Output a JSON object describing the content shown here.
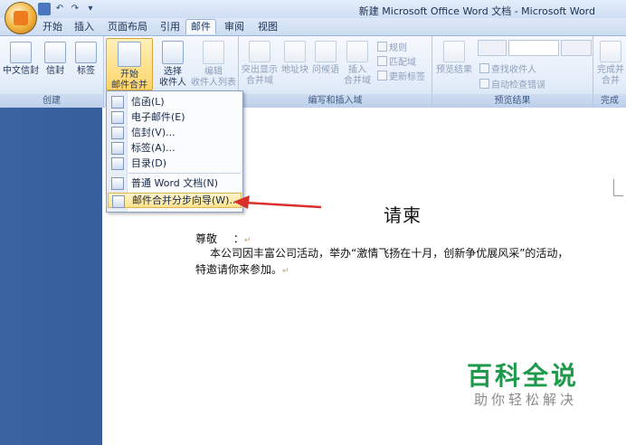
{
  "title": "新建 Microsoft Office Word 文档 - Microsoft Word",
  "tabs": [
    "开始",
    "插入",
    "页面布局",
    "引用",
    "邮件",
    "审阅",
    "视图"
  ],
  "ribbon": {
    "create": {
      "label": "创建",
      "buttons": [
        "中文信封",
        "信封",
        "标签"
      ]
    },
    "start": {
      "btn1_line1": "开始",
      "btn1_line2": "邮件合并",
      "btn2_line1": "选择",
      "btn2_line2": "收件人",
      "btn3_line1": "编辑",
      "btn3_line2": "收件人列表"
    },
    "write": {
      "label": "编写和插入域",
      "b1_line1": "突出显示",
      "b1_line2": "合并域",
      "b2": "地址块",
      "b3": "问候语",
      "b4_line1": "插入",
      "b4_line2": "合并域",
      "rules": "规则",
      "match": "匹配域",
      "update": "更新标签"
    },
    "preview": {
      "label": "预览结果",
      "btn": "预览结果",
      "find": "查找收件人",
      "check": "自动检查错误"
    },
    "finish": {
      "label": "完成",
      "line1": "完成并",
      "line2": "合并"
    }
  },
  "menu": {
    "items": [
      "信函(L)",
      "电子邮件(E)",
      "信封(V)...",
      "标签(A)...",
      "目录(D)",
      "普通 Word 文档(N)",
      "邮件合并分步向导(W)..."
    ],
    "selected_index": 6
  },
  "document": {
    "heading": "请柬",
    "salutation": "尊敬",
    "colon": "：",
    "line1": "本公司因丰富公司活动，举办“激情飞扬在十月，创新争优展风采”的活动，",
    "line2": "特邀请你来参加。"
  },
  "watermark": {
    "title": "百科全说",
    "subtitle": "助你轻松解决"
  },
  "colors": {
    "accent_arrow": "#d9302c",
    "watermark_green": "#1e9a4c"
  }
}
